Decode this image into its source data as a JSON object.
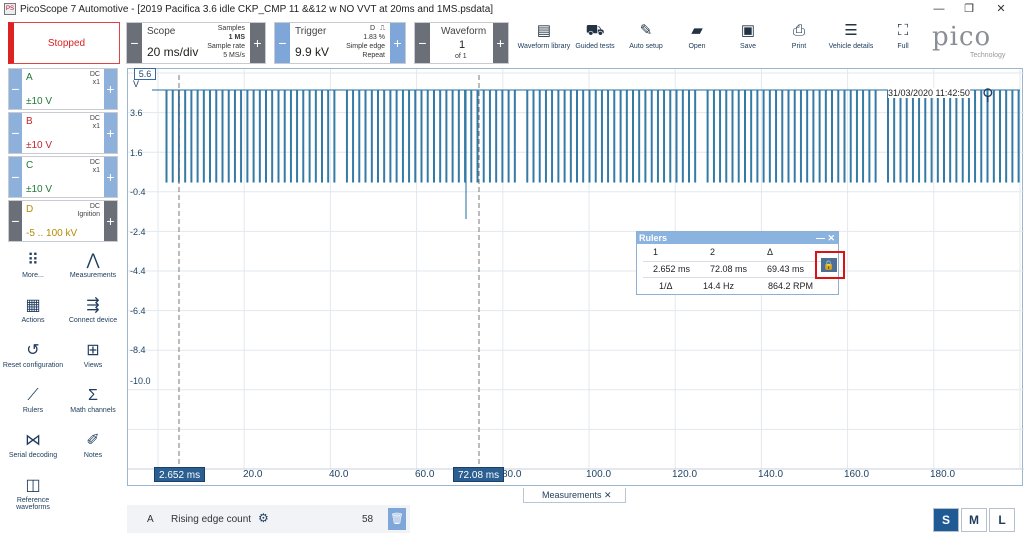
{
  "window": {
    "title": "PicoScope 7 Automotive - [2019 Pacifica 3.6 idle CKP_CMP 11 &&12 w NO VVT at 20ms and 1MS.psdata]",
    "app_icon_text": "PS",
    "controls": [
      "—",
      "❐",
      "✕"
    ]
  },
  "toolbar": {
    "status": "Stopped",
    "scope": {
      "label": "Scope",
      "value": "20 ms/div",
      "samples_label": "Samples",
      "samples_value": "1 MS",
      "rate_label": "Sample rate",
      "rate_value": "5 MS/s"
    },
    "trigger": {
      "label": "Trigger",
      "value": "9.9 kV",
      "channel": "D",
      "percent": "1.83 %",
      "mode": "Simple edge",
      "repeat": "Repeat"
    },
    "waveform": {
      "label": "Waveform",
      "value": "1",
      "of": "of 1"
    },
    "buttons": [
      {
        "id": "waveform-library",
        "label": "Waveform library",
        "icon": "book-icon"
      },
      {
        "id": "guided-tests",
        "label": "Guided tests",
        "icon": "car-icon"
      },
      {
        "id": "auto-setup",
        "label": "Auto setup",
        "icon": "wand-icon"
      },
      {
        "id": "open",
        "label": "Open",
        "icon": "folder-icon"
      },
      {
        "id": "save",
        "label": "Save",
        "icon": "save-icon"
      },
      {
        "id": "print",
        "label": "Print",
        "icon": "printer-icon"
      },
      {
        "id": "vehicle-details",
        "label": "Vehicle details",
        "icon": "clipboard-icon"
      },
      {
        "id": "full",
        "label": "Full",
        "icon": "fullscreen-icon"
      }
    ],
    "logo": {
      "text": "pico",
      "sub": "Technology"
    }
  },
  "channels": [
    {
      "name": "A",
      "coupling": "DC",
      "probe": "x1",
      "range": "±10 V",
      "color": "#1f7a3a"
    },
    {
      "name": "B",
      "coupling": "DC",
      "probe": "x1",
      "range": "±10 V",
      "color": "#c0262f"
    },
    {
      "name": "C",
      "coupling": "DC",
      "probe": "x1",
      "range": "±10 V",
      "color": "#1f7a3a"
    },
    {
      "name": "D",
      "coupling": "DC",
      "probe": "Ignition",
      "range": "-5 .. 100 kV",
      "color": "#b68a00"
    }
  ],
  "tools": [
    {
      "id": "more",
      "label": "More...",
      "icon": "grid-icon"
    },
    {
      "id": "measurements",
      "label": "Measurements",
      "icon": "compass-icon"
    },
    {
      "id": "actions",
      "label": "Actions",
      "icon": "clapper-icon"
    },
    {
      "id": "connect-device",
      "label": "Connect device",
      "icon": "usb-icon"
    },
    {
      "id": "reset-configuration",
      "label": "Reset configuration",
      "icon": "reset-icon"
    },
    {
      "id": "views",
      "label": "Views",
      "icon": "views-icon"
    },
    {
      "id": "rulers",
      "label": "Rulers",
      "icon": "ruler-icon"
    },
    {
      "id": "math-channels",
      "label": "Math channels",
      "icon": "sigma-icon"
    },
    {
      "id": "serial-decoding",
      "label": "Serial decoding",
      "icon": "serial-icon"
    },
    {
      "id": "notes",
      "label": "Notes",
      "icon": "notes-icon"
    },
    {
      "id": "reference-waveforms",
      "label": "Reference waveforms",
      "icon": "reference-icon"
    }
  ],
  "plot": {
    "y_ticks": [
      "5.6",
      "3.6",
      "1.6",
      "-0.4",
      "-2.4",
      "-4.4",
      "-6.4",
      "-8.4",
      "-10.0"
    ],
    "x_ticks": [
      "20.0",
      "40.0",
      "60.0",
      "80.0",
      "100.0",
      "120.0",
      "140.0",
      "160.0",
      "180.0"
    ],
    "ruler_1": "2.652 ms",
    "ruler_2": "72.08 ms",
    "timestamp": "31/03/2020 11:42:50",
    "scale_tag": "5.6",
    "unit_tag": "V"
  },
  "rulers_panel": {
    "title": "Rulers",
    "headers": [
      "1",
      "2",
      "Δ"
    ],
    "values": [
      "2.652 ms",
      "72.08 ms",
      "69.43 ms"
    ],
    "inv_label": "1/Δ",
    "freq": "14.4 Hz",
    "rpm": "864.2 RPM"
  },
  "measurements": {
    "tab_label": "Measurements",
    "rows": [
      {
        "channel": "A",
        "name": "Rising edge count",
        "value": "58"
      }
    ]
  },
  "size_buttons": [
    "S",
    "M",
    "L"
  ]
}
